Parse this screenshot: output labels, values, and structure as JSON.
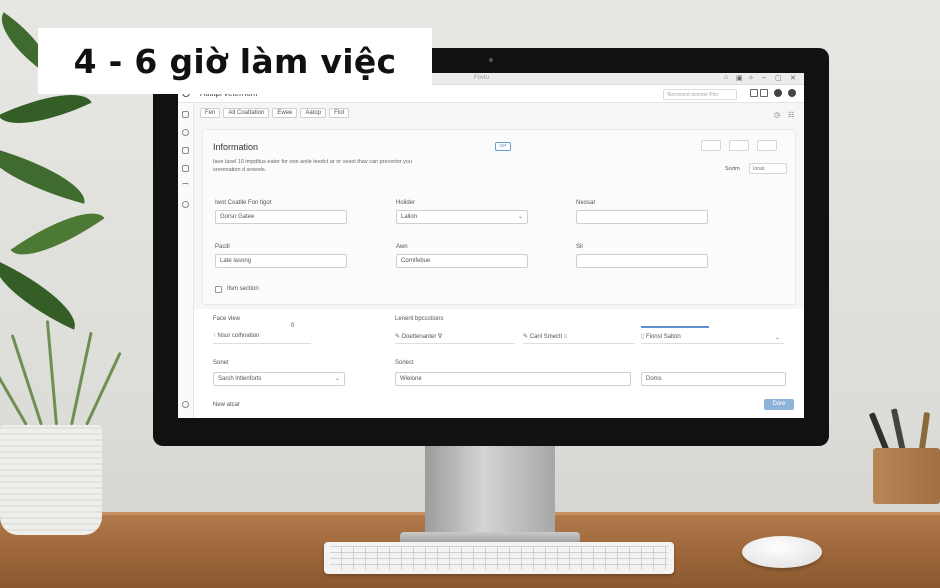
{
  "headline": "4 - 6 giờ làm việc",
  "screen": {
    "window_title": "Fovtu",
    "app_title": "Atltitpi veternom",
    "search_placeholder": "Sernnorst donoter Pter",
    "tabs": [
      "Fen",
      "Alt Coattation",
      "Ewee",
      "Aatop",
      "Ftol"
    ],
    "card": {
      "title": "Information",
      "description": "Iave laxel 10 impditus eater for one anile teedct ar or veset thav can precertor you srerenation d sroeets.",
      "pill": "cer",
      "sort_label": "Sortm",
      "sort_value": "Iooat"
    },
    "fields": [
      {
        "label": "Iwot Coatlle Fon tlgot",
        "value": "Gorsn Gatee"
      },
      {
        "label": "Hoilder",
        "value": "Lalion"
      },
      {
        "label": "Neosat",
        "value": ""
      },
      {
        "label": "Pacitl",
        "value": "Late lasong"
      },
      {
        "label": "Awn",
        "value": "Cornifebue"
      },
      {
        "label": "Sil",
        "value": ""
      }
    ],
    "checkbox_label": "Ilsm section",
    "lower": {
      "face_view_label": "Face vlew",
      "face_view_count": "0",
      "face_view_value": "Nsur colhnation",
      "recent_label": "Lenent bpcsstions",
      "recent_a": "Doettenanter ∇",
      "recent_b": "Canl Smectl",
      "recent_c": "Flonsl Salton",
      "select_label_a": "Sonet",
      "select_value_a": "Sarch lntlenforts",
      "select_label_b": "Sorlect",
      "select_value_b": "Wielone",
      "select_value_c": "Doms",
      "footer_text": "New atcar",
      "done_button": "Dore"
    }
  }
}
